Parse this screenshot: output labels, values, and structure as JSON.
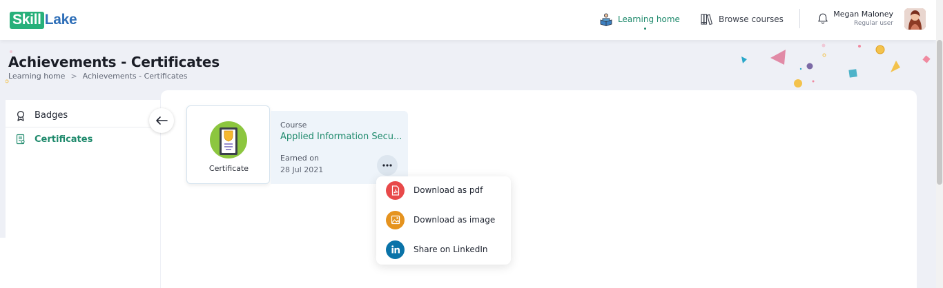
{
  "header": {
    "logo_part1": "Skill",
    "logo_part2": "Lake",
    "nav": {
      "learning_home": "Learning home",
      "browse_courses": "Browse courses"
    },
    "user": {
      "name": "Megan Maloney",
      "role": "Regular user"
    }
  },
  "page": {
    "title": "Achievements - Certificates",
    "breadcrumb": {
      "home": "Learning home",
      "separator": ">",
      "current": "Achievements - Certificates"
    }
  },
  "sidebar": {
    "items": [
      {
        "label": "Badges",
        "icon": "ribbon-icon"
      },
      {
        "label": "Certificates",
        "icon": "certificate-icon",
        "active": true
      }
    ]
  },
  "certificate": {
    "card_label": "Certificate",
    "course_label": "Course",
    "course_name": "Applied Information Secu...",
    "earned_label": "Earned on",
    "earned_date": "28 Jul 2021"
  },
  "menu": {
    "items": [
      {
        "label": "Download as pdf",
        "icon": "pdf-icon",
        "color": "#e8494a"
      },
      {
        "label": "Download as image",
        "icon": "image-icon",
        "color": "#e5931f"
      },
      {
        "label": "Share on LinkedIn",
        "icon": "linkedin-icon",
        "color": "#0a73a8"
      }
    ]
  },
  "colors": {
    "accent": "#1f8a6c",
    "brand_green": "#27b07a",
    "brand_blue": "#2f6fb8",
    "background": "#eef0f6"
  }
}
